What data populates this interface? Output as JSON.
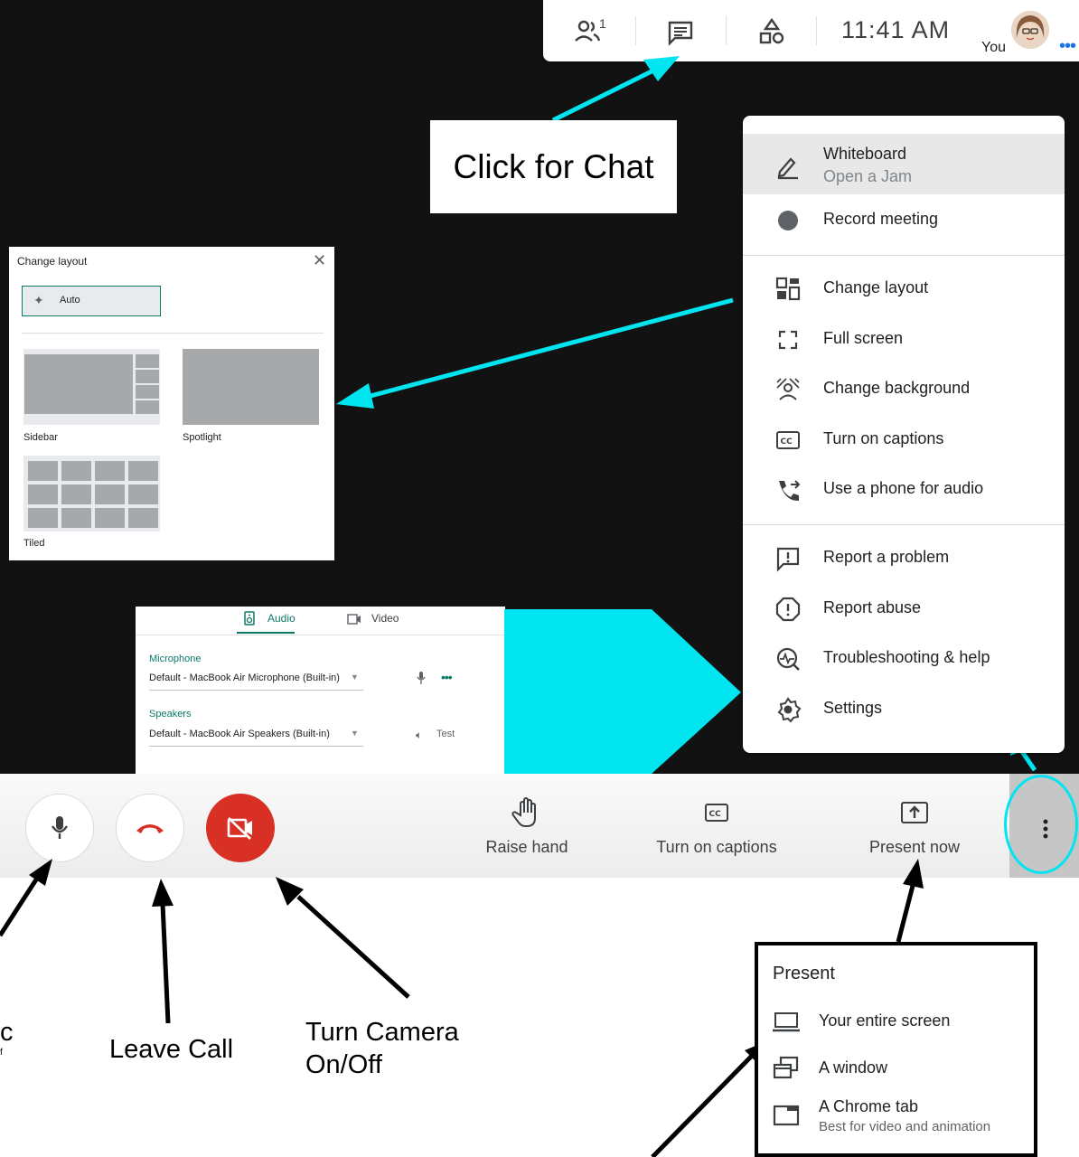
{
  "topbar": {
    "people_count": "1",
    "clock": "11:41  AM",
    "self_label": "You",
    "icons": [
      "people-icon",
      "chat-icon",
      "activities-icon",
      "more-dots-icon"
    ]
  },
  "callout_chat": "Click for Chat",
  "more_menu": {
    "items": [
      {
        "label": "Whiteboard",
        "sublabel": "Open a Jam",
        "icon": "pen-icon"
      },
      {
        "label": "Record meeting",
        "icon": "record-icon"
      },
      {
        "label": "Change layout",
        "icon": "layout-icon"
      },
      {
        "label": "Full screen",
        "icon": "fullscreen-icon"
      },
      {
        "label": "Change background",
        "icon": "background-icon"
      },
      {
        "label": "Turn on captions",
        "icon": "captions-icon"
      },
      {
        "label": "Use a phone for audio",
        "icon": "phone-icon"
      },
      {
        "label": "Report a problem",
        "icon": "feedback-icon"
      },
      {
        "label": "Report abuse",
        "icon": "report-icon"
      },
      {
        "label": "Troubleshooting & help",
        "icon": "troubleshoot-icon"
      },
      {
        "label": "Settings",
        "icon": "gear-icon"
      }
    ]
  },
  "layout_panel": {
    "title": "Change layout",
    "auto_label": "Auto",
    "options": [
      "Sidebar",
      "Spotlight",
      "Tiled"
    ]
  },
  "audio_panel": {
    "tabs": [
      "Audio",
      "Video"
    ],
    "microphone_label": "Microphone",
    "microphone_value": "Default - MacBook Air Microphone (Built-in)",
    "speakers_label": "Speakers",
    "speakers_value": "Default - MacBook Air Speakers (Built-in)",
    "test_label": "Test"
  },
  "toolbar": {
    "raise_hand": "Raise hand",
    "captions": "Turn on captions",
    "present": "Present now"
  },
  "annotations": {
    "mic_partial_1": "c",
    "mic_partial_2": "f",
    "leave_call": "Leave Call",
    "camera_line1": "Turn Camera",
    "camera_line2": "On/Off"
  },
  "present_menu": {
    "title": "Present",
    "items": [
      {
        "label": "Your entire screen",
        "icon": "laptop-icon"
      },
      {
        "label": "A window",
        "icon": "window-icon"
      },
      {
        "label": "A Chrome tab",
        "sublabel": "Best for video and animation",
        "icon": "tab-icon"
      }
    ]
  },
  "colors": {
    "background": "#121212",
    "cyan": "#00e5f0",
    "accent": "#0b7a66",
    "camera_off": "#d93025",
    "hangup": "#d93025"
  }
}
